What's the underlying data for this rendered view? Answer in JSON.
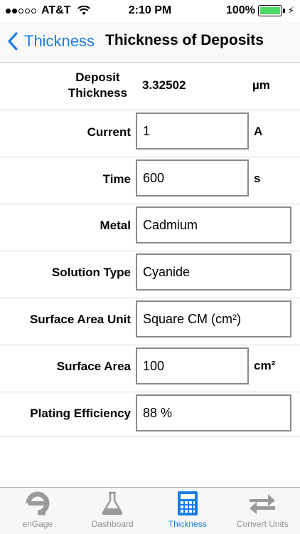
{
  "status_bar": {
    "carrier": "AT&T",
    "time": "2:10 PM",
    "battery_percent": "100%",
    "signal_bars_filled": 2,
    "signal_bars_total": 5
  },
  "nav": {
    "back_label": "Thickness",
    "title": "Thickness of Deposits"
  },
  "form": {
    "deposit_thickness": {
      "label_line1": "Deposit",
      "label_line2": "Thickness",
      "value": "3.32502",
      "unit": "µm"
    },
    "current": {
      "label": "Current",
      "value": "1",
      "unit": "A"
    },
    "time": {
      "label": "Time",
      "value": "600",
      "unit": "s"
    },
    "metal": {
      "label": "Metal",
      "value": "Cadmium"
    },
    "solution_type": {
      "label": "Solution Type",
      "value": "Cyanide"
    },
    "surface_area_unit": {
      "label": "Surface Area Unit",
      "value": "Square CM (cm²)"
    },
    "surface_area": {
      "label": "Surface Area",
      "value": "100",
      "unit": "cm²"
    },
    "plating_efficiency": {
      "label": "Plating Efficiency",
      "value": "88 %"
    }
  },
  "tab_bar": {
    "tabs": [
      {
        "label": "enGage",
        "icon": "engage-logo-icon",
        "active": false
      },
      {
        "label": "Dashboard",
        "icon": "flask-icon",
        "active": false
      },
      {
        "label": "Thickness",
        "icon": "calculator-icon",
        "active": true
      },
      {
        "label": "Convert Units",
        "icon": "swap-arrows-icon",
        "active": false
      }
    ]
  },
  "colors": {
    "accent": "#1a7ee8",
    "inactive": "#8e8e93",
    "battery": "#4cd964"
  }
}
